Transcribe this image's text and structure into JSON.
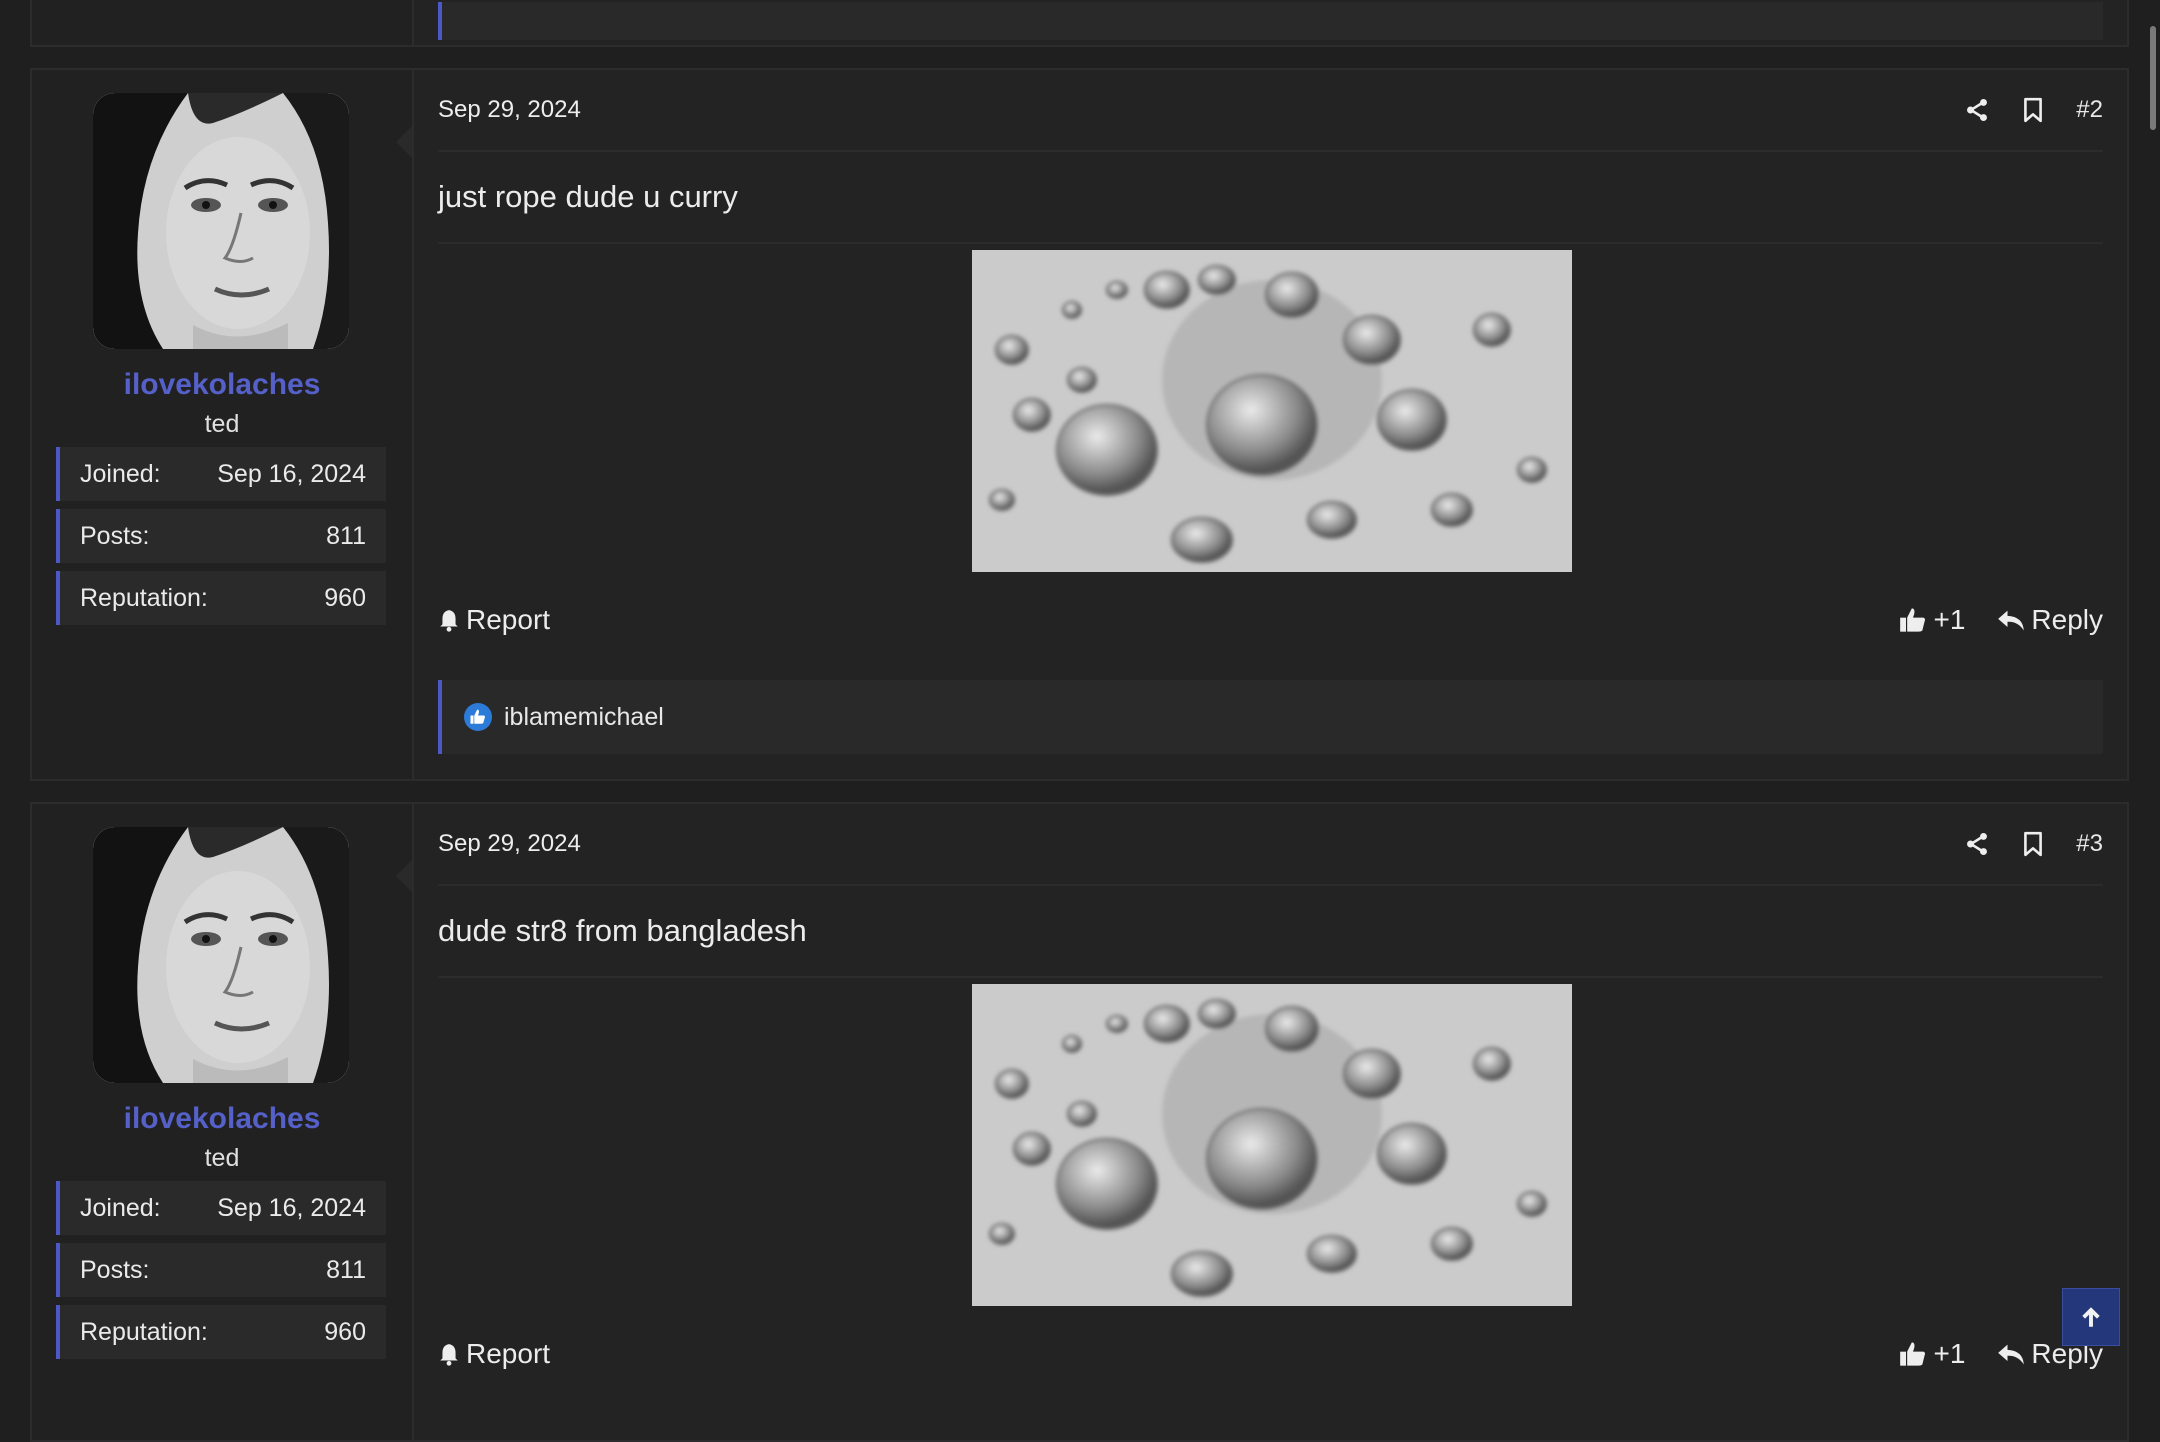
{
  "posts": [
    {
      "date": "Sep 29, 2024",
      "number": "#2",
      "body": "just rope dude u curry",
      "user": {
        "name": "ilovekolaches",
        "title": "ted",
        "stats": [
          {
            "label": "Joined:",
            "value": "Sep 16, 2024"
          },
          {
            "label": "Posts:",
            "value": "811"
          },
          {
            "label": "Reputation:",
            "value": "960"
          }
        ]
      },
      "actions": {
        "report": "Report",
        "like": "+1",
        "reply": "Reply"
      },
      "reactions": {
        "users": "iblamemichael"
      }
    },
    {
      "date": "Sep 29, 2024",
      "number": "#3",
      "body": "dude str8 from bangladesh",
      "user": {
        "name": "ilovekolaches",
        "title": "ted",
        "stats": [
          {
            "label": "Joined:",
            "value": "Sep 16, 2024"
          },
          {
            "label": "Posts:",
            "value": "811"
          },
          {
            "label": "Reputation:",
            "value": "960"
          }
        ]
      },
      "actions": {
        "report": "Report",
        "like": "+1",
        "reply": "Reply"
      }
    }
  ],
  "icons": {
    "share": "share-icon",
    "bookmark": "bookmark-icon",
    "report": "bell-icon",
    "like": "thumbs-up-icon",
    "reply": "reply-icon",
    "scroll_top": "arrow-up-icon"
  },
  "colors": {
    "background": "#1f1f20",
    "panel": "#232324",
    "accent": "#4c57c8",
    "username": "#5560c8",
    "scroll_top_button": "#24377a"
  }
}
